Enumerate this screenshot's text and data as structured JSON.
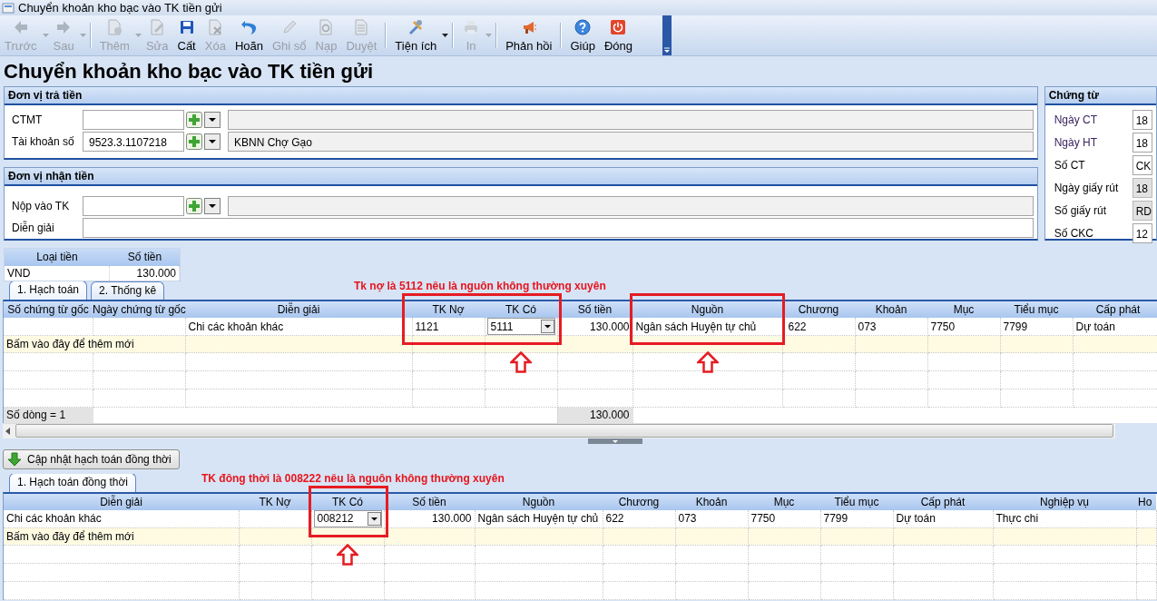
{
  "window": {
    "title": "Chuyển khoản kho bạc vào TK tiền gửi"
  },
  "toolbar": [
    {
      "kind": "button",
      "label": "Trước",
      "disabled": true,
      "menu": true
    },
    {
      "kind": "button",
      "label": "Sau",
      "disabled": true,
      "menu": true
    },
    {
      "kind": "separator"
    },
    {
      "kind": "button",
      "label": "Thêm",
      "disabled": true,
      "menu": true
    },
    {
      "kind": "button",
      "label": "Sửa",
      "disabled": true,
      "menu": false
    },
    {
      "kind": "button",
      "label": "Cất",
      "disabled": false,
      "menu": false
    },
    {
      "kind": "button",
      "label": "Xóa",
      "disabled": true,
      "menu": false
    },
    {
      "kind": "button",
      "label": "Hoãn",
      "disabled": false,
      "menu": false
    },
    {
      "kind": "button",
      "label": "Ghi sổ",
      "disabled": true,
      "menu": false
    },
    {
      "kind": "button",
      "label": "Nạp",
      "disabled": true,
      "menu": false
    },
    {
      "kind": "button",
      "label": "Duyệt",
      "disabled": true,
      "menu": false
    },
    {
      "kind": "separator"
    },
    {
      "kind": "button",
      "label": "Tiện ích",
      "disabled": false,
      "menu": true
    },
    {
      "kind": "separator"
    },
    {
      "kind": "button",
      "label": "In",
      "disabled": true,
      "menu": true
    },
    {
      "kind": "separator"
    },
    {
      "kind": "button",
      "label": "Phản hồi",
      "disabled": false,
      "menu": false
    },
    {
      "kind": "separator"
    },
    {
      "kind": "button",
      "label": "Giúp",
      "disabled": false,
      "menu": false
    },
    {
      "kind": "button",
      "label": "Đóng",
      "disabled": false,
      "menu": false
    }
  ],
  "heading": "Chuyển khoản kho bạc vào TK tiền gửi",
  "payer": {
    "title": "Đơn vị trả tiền",
    "fields": [
      {
        "kind": "lookup",
        "label": "CTMT"
      },
      {
        "kind": "lookup",
        "label": "Tài khoản số",
        "value": "9523.3.1107218",
        "description": "KBNN Chợ Gạo"
      }
    ]
  },
  "payee": {
    "title": "Đơn vị nhận tiền",
    "fields": [
      {
        "kind": "lookup",
        "label": "Nộp vào TK"
      },
      {
        "kind": "text",
        "label": "Diễn giải"
      }
    ]
  },
  "voucher": {
    "title": "Chứng từ",
    "fields": [
      {
        "label": "Ngày CT",
        "value": "18",
        "disabled": false
      },
      {
        "label": "Ngày HT",
        "value": "18",
        "disabled": false
      },
      {
        "label": "Số CT",
        "value": "CK",
        "disabled": false
      },
      {
        "label": "Ngày giấy rút",
        "value": "18",
        "disabled": true
      },
      {
        "label": "Số giấy rút",
        "value": "RD",
        "disabled": true
      },
      {
        "label": "Số CKC",
        "value": "12",
        "disabled": false
      }
    ]
  },
  "currency": {
    "columns": [
      "Loại tiền",
      "Số tiền"
    ],
    "rows": [
      [
        "VND",
        "130.000"
      ]
    ]
  },
  "accounting": {
    "tabs": [
      {
        "label": "1. Hạch toán",
        "selected": true
      },
      {
        "label": "2. Thống kê",
        "selected": false
      }
    ],
    "note": "Tk nợ là 5112 nếu là nguồn không thường xuyên",
    "columns": [
      {
        "label": "Số chứng từ gốc",
        "kind": "text",
        "highlighted": false
      },
      {
        "label": "Ngày chứng từ gốc",
        "kind": "text",
        "highlighted": false
      },
      {
        "label": "Diễn giải",
        "kind": "text",
        "highlighted": false
      },
      {
        "label": "TK Nợ",
        "kind": "text",
        "highlighted": true
      },
      {
        "label": "TK Có",
        "kind": "text",
        "highlighted": true
      },
      {
        "label": "Số tiền",
        "kind": "amount",
        "highlighted": false
      },
      {
        "label": "Nguồn",
        "kind": "text",
        "highlighted": true
      },
      {
        "label": "Chương",
        "kind": "text",
        "highlighted": false
      },
      {
        "label": "Khoản",
        "kind": "text",
        "highlighted": false
      },
      {
        "label": "Mục",
        "kind": "text",
        "highlighted": false
      },
      {
        "label": "Tiểu mục",
        "kind": "text",
        "highlighted": false
      },
      {
        "label": "Cấp phát",
        "kind": "text",
        "highlighted": false
      }
    ],
    "rows": [
      [
        null,
        null,
        "Chi các khoản khác",
        "1121",
        {
          "kind": "combo",
          "text": "5111"
        },
        "130.000",
        "Ngân sách Huyện tự chủ",
        "622",
        "073",
        "7750",
        "7799",
        "Dự toán"
      ]
    ],
    "new_row": "Bấm vào đây để thêm mới",
    "footer": {
      "count": "Số dòng = 1",
      "total": "130.000"
    }
  },
  "sync_button": {
    "label": "Cập nhật hạch toán đồng thời"
  },
  "simultaneous": {
    "tabs": [
      {
        "label": "1. Hạch toán đồng thời",
        "selected": true
      }
    ],
    "note": "TK đồng thời là 008222 nếu là nguồn không thường xuyên",
    "columns": [
      {
        "label": "Diễn giải",
        "kind": "text",
        "highlighted": false
      },
      {
        "label": "TK Nợ",
        "kind": "text",
        "highlighted": false
      },
      {
        "label": "TK Có",
        "kind": "text",
        "highlighted": true
      },
      {
        "label": "Số tiền",
        "kind": "amount",
        "highlighted": false
      },
      {
        "label": "Nguồn",
        "kind": "text",
        "highlighted": false
      },
      {
        "label": "Chương",
        "kind": "text",
        "highlighted": false
      },
      {
        "label": "Khoản",
        "kind": "text",
        "highlighted": false
      },
      {
        "label": "Mục",
        "kind": "text",
        "highlighted": false
      },
      {
        "label": "Tiểu mục",
        "kind": "text",
        "highlighted": false
      },
      {
        "label": "Cấp phát",
        "kind": "text",
        "highlighted": false
      },
      {
        "label": "Nghiệp vụ",
        "kind": "text",
        "highlighted": false
      },
      {
        "label": "Ho",
        "kind": "text",
        "highlighted": false
      }
    ],
    "rows": [
      [
        "Chi các khoản khác",
        null,
        {
          "kind": "combo",
          "text": "008212"
        },
        "130.000",
        "Ngân sách Huyện tự chủ",
        "622",
        "073",
        "7750",
        "7799",
        "Dự toán",
        "Thực chi",
        null
      ]
    ],
    "new_row": "Bấm vào đây để thêm mới"
  }
}
